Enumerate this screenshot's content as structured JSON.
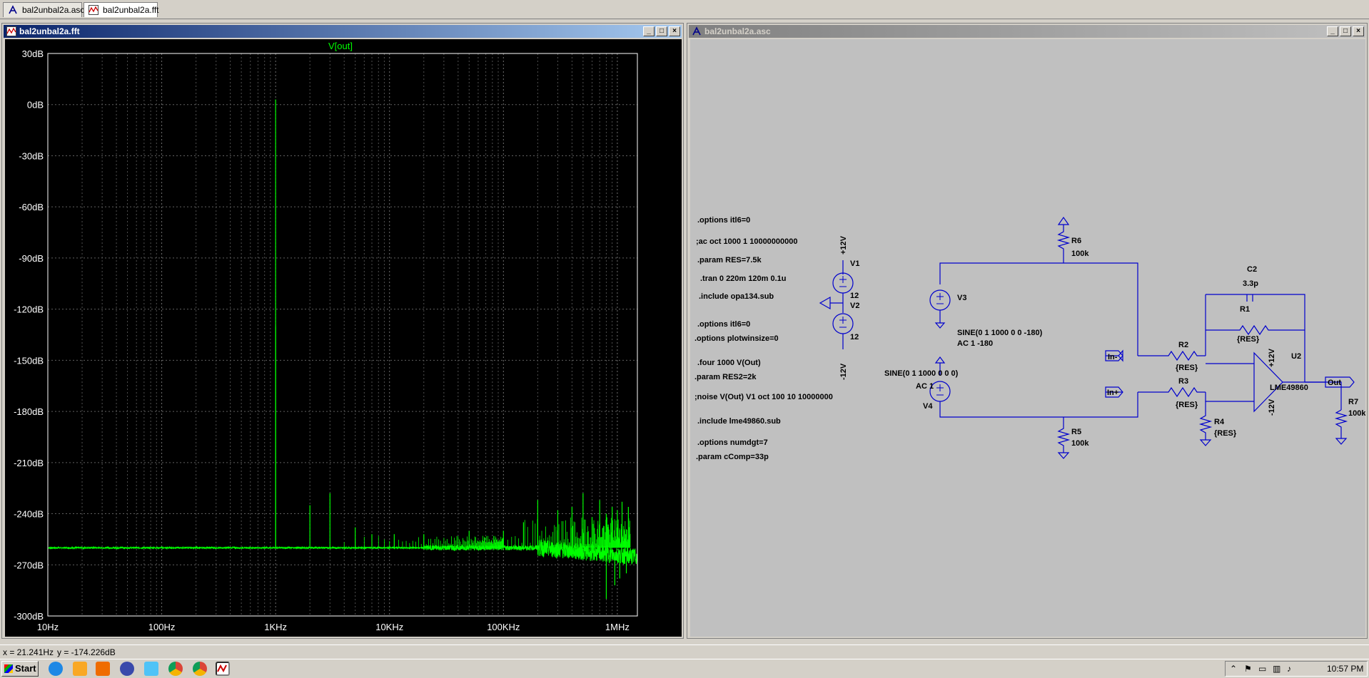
{
  "tabs": [
    {
      "label": "bal2unbal2a.asc",
      "icon": "schematic-icon"
    },
    {
      "label": "bal2unbal2a.fft",
      "icon": "waveform-icon"
    }
  ],
  "fft_window": {
    "title": "bal2unbal2a.fft"
  },
  "schematic_window": {
    "title": "bal2unbal2a.asc"
  },
  "chart_data": {
    "type": "line",
    "title": "V[out]",
    "x_scale": "log",
    "xlim": [
      10,
      1500000
    ],
    "ylim": [
      -300,
      30
    ],
    "y_ticks": [
      "30dB",
      "0dB",
      "-30dB",
      "-60dB",
      "-90dB",
      "-120dB",
      "-150dB",
      "-180dB",
      "-210dB",
      "-240dB",
      "-270dB",
      "-300dB"
    ],
    "y_tick_values": [
      30,
      0,
      -30,
      -60,
      -90,
      -120,
      -150,
      -180,
      -210,
      -240,
      -270,
      -300
    ],
    "x_ticks": [
      "10Hz",
      "100Hz",
      "1KHz",
      "10KHz",
      "100KHz",
      "1MHz"
    ],
    "x_tick_values": [
      10,
      100,
      1000,
      10000,
      100000,
      1000000
    ],
    "grid": true,
    "series": [
      {
        "name": "V[out]",
        "color": "#00ff00",
        "noise_floor_db": -260,
        "spikes": [
          {
            "freq": 1000,
            "db": 3
          },
          {
            "freq": 1000,
            "db": -130
          },
          {
            "freq": 2000,
            "db": -235
          },
          {
            "freq": 3000,
            "db": -228
          },
          {
            "freq": 5000,
            "db": -248
          },
          {
            "freq": 7000,
            "db": -252
          },
          {
            "freq": 11000,
            "db": -252
          },
          {
            "freq": 20000,
            "db": -252
          },
          {
            "freq": 50000,
            "db": -250
          },
          {
            "freq": 100000,
            "db": -250
          },
          {
            "freq": 150000,
            "db": -245
          },
          {
            "freq": 200000,
            "db": -232
          },
          {
            "freq": 300000,
            "db": -238
          },
          {
            "freq": 400000,
            "db": -236
          },
          {
            "freq": 500000,
            "db": -228
          },
          {
            "freq": 600000,
            "db": -242
          },
          {
            "freq": 700000,
            "db": -232
          },
          {
            "freq": 800000,
            "db": -240
          },
          {
            "freq": 900000,
            "db": -236
          },
          {
            "freq": 1000000,
            "db": -238
          },
          {
            "freq": 1100000,
            "db": -233
          },
          {
            "freq": 1250000,
            "db": -236
          }
        ],
        "dips": [
          {
            "freq": 800000,
            "db": -290
          },
          {
            "freq": 950000,
            "db": -282
          },
          {
            "freq": 1050000,
            "db": -278
          },
          {
            "freq": 1200000,
            "db": -275
          }
        ]
      }
    ]
  },
  "directives": [
    ".options itl6=0",
    ";ac oct 1000 1 10000000000",
    ".param RES=7.5k",
    ".tran 0 220m 120m 0.1u",
    ".include opa134.sub",
    ".options itl6=0",
    ".options plotwinsize=0",
    ".four 1000 V(Out)",
    ".param RES2=2k",
    ";noise V(Out) V1 oct 100 10 10000000",
    ".include lme49860.sub",
    ".options numdgt=7",
    ".param cComp=33p"
  ],
  "schematic": {
    "v1": {
      "name": "V1",
      "value": "12"
    },
    "v2": {
      "name": "V2",
      "value": "12"
    },
    "v3": {
      "name": "V3",
      "value": "SINE(0 1 1000 0 0 -180)",
      "ac": "AC 1 -180"
    },
    "v4": {
      "name": "V4",
      "value": "SINE(0 1 1000 0 0 0)",
      "ac": "AC 1"
    },
    "pos_supply": "+12V",
    "neg_supply": "-12V",
    "r1": {
      "name": "R1",
      "value": "{RES}"
    },
    "r2": {
      "name": "R2",
      "value": "{RES}"
    },
    "r3": {
      "name": "R3",
      "value": "{RES}"
    },
    "r4": {
      "name": "R4",
      "value": "{RES}"
    },
    "r5": {
      "name": "R5",
      "value": "100k"
    },
    "r6": {
      "name": "R6",
      "value": "100k"
    },
    "r7": {
      "name": "R7",
      "value": "100k"
    },
    "c2": {
      "name": "C2",
      "value": "3.3p"
    },
    "u2": {
      "name": "U2",
      "value": "LME49860"
    },
    "label_in_minus": "In-",
    "label_in_plus": "In+",
    "label_out": "Out",
    "wire_color": "#0000cc"
  },
  "statusbar": {
    "x_readout": "x = 21.241Hz",
    "y_readout": "y = -174.226dB"
  },
  "taskbar": {
    "start_label": "Start",
    "clock": "10:57 PM"
  }
}
